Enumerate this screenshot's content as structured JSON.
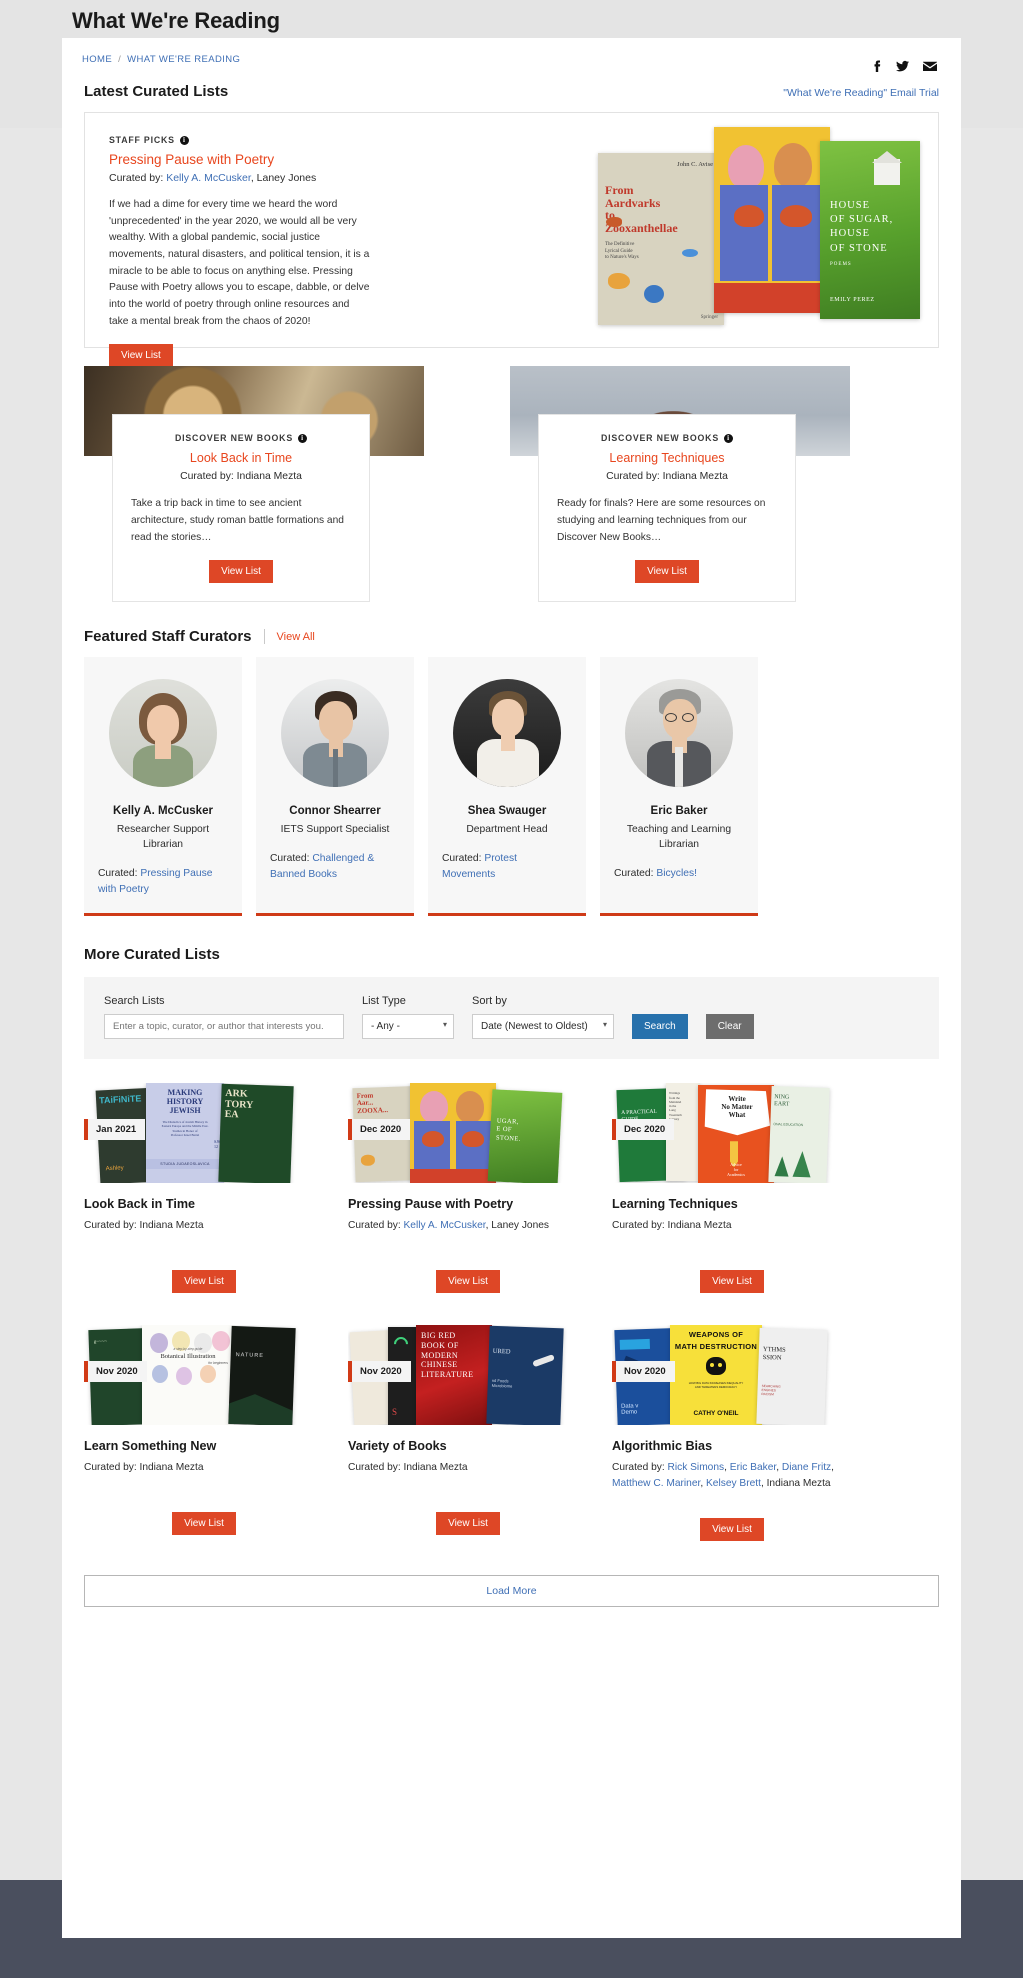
{
  "page_heading": "What We're Reading",
  "breadcrumb": {
    "home": "HOME",
    "separator": "/",
    "current": "WHAT WE'RE READING"
  },
  "social": {
    "facebook": "facebook-icon",
    "twitter": "twitter-icon",
    "email": "email-icon"
  },
  "latest": {
    "heading": "Latest Curated Lists",
    "email_trial": "\"What We're Reading\" Email Trial"
  },
  "hero": {
    "kicker": "STAFF PICKS",
    "info_glyph": "i",
    "title": "Pressing Pause with Poetry",
    "curated_prefix": "Curated by: ",
    "curator_link": "Kelly A. McCusker",
    "curator_rest": ", Laney Jones",
    "description": "If we had a dime for every time we heard the word 'unprecedented' in the year 2020, we would all be very wealthy. With a global pandemic, social justice movements, natural disasters, and political tension, it is a miracle to be able to focus on anything else. Pressing Pause with Poetry allows you to escape, dabble, or delve into the world of poetry through online resources and take a mental break from the chaos of 2020!",
    "button": "View List",
    "books": [
      {
        "title": "From Aardvarks to Zooxanthellae",
        "author": "John C. Avise",
        "subtitle": "The Definitive Lyrical Guide to Nature's Ways",
        "publisher": "Springer"
      },
      {
        "title": "House of Sugar, House of Stone",
        "author": "Emily Perez"
      }
    ]
  },
  "discover_cards": [
    {
      "kicker": "DISCOVER NEW BOOKS",
      "title": "Look Back in Time",
      "curated": "Curated by: Indiana Mezta",
      "description": "Take a trip back in time to see ancient architecture, study roman battle formations and read the stories…",
      "button": "View List",
      "image": "pocket-watches-photo"
    },
    {
      "kicker": "DISCOVER NEW BOOKS",
      "title": "Learning Techniques",
      "curated": "Curated by: Indiana Mezta",
      "description": "Ready for finals? Here are some resources on studying and learning techniques from our Discover New Books…",
      "button": "View List",
      "image": "student-at-desk-photo"
    }
  ],
  "curators_section": {
    "heading": "Featured Staff Curators",
    "view_all": "View All",
    "items": [
      {
        "name": "Kelly A. McCusker",
        "role": "Researcher Support Librarian",
        "curated_prefix": "Curated: ",
        "curated_link": "Pressing Pause with Poetry"
      },
      {
        "name": "Connor Shearrer",
        "role": "IETS Support Specialist",
        "curated_prefix": "Curated: ",
        "curated_link": "Challenged & Banned Books"
      },
      {
        "name": "Shea Swauger",
        "role": "Department Head",
        "curated_prefix": "Curated: ",
        "curated_link": "Protest Movements"
      },
      {
        "name": "Eric Baker",
        "role": "Teaching and Learning Librarian",
        "curated_prefix": "Curated: ",
        "curated_link": "Bicycles!"
      }
    ]
  },
  "more_section": {
    "heading": "More Curated Lists",
    "search_label": "Search Lists",
    "search_placeholder": "Enter a topic, curator, or author that interests you.",
    "search_value": "",
    "list_type_label": "List Type",
    "list_type_value": "- Any -",
    "sort_label": "Sort by",
    "sort_value": "Date (Newest to Oldest)",
    "search_button": "Search",
    "clear_button": "Clear"
  },
  "results": [
    {
      "date": "Jan 2021",
      "title": "Look Back in Time",
      "curated_prefix": "Curated by: ",
      "curated_plain": "Indiana Mezta",
      "curated_links": [],
      "button": "View List"
    },
    {
      "date": "Dec 2020",
      "title": "Pressing Pause with Poetry",
      "curated_prefix": "Curated by: ",
      "curated_plain": ", Laney Jones",
      "curated_links": [
        "Kelly A. McCusker"
      ],
      "button": "View List"
    },
    {
      "date": "Dec 2020",
      "title": "Learning Techniques",
      "curated_prefix": "Curated by: ",
      "curated_plain": "Indiana Mezta",
      "curated_links": [],
      "button": "View List"
    },
    {
      "date": "Nov 2020",
      "title": "Learn Something New",
      "curated_prefix": "Curated by: ",
      "curated_plain": "Indiana Mezta",
      "curated_links": [],
      "button": "View List"
    },
    {
      "date": "Nov 2020",
      "title": "Variety of Books",
      "curated_prefix": "Curated by: ",
      "curated_plain": "Indiana Mezta",
      "curated_links": [],
      "button": "View List"
    },
    {
      "date": "Nov 2020",
      "title": "Algorithmic Bias",
      "curated_prefix": "Curated by: ",
      "curated_plain": ", Indiana Mezta",
      "curated_links": [
        "Rick Simons",
        "Eric Baker",
        "Diane Fritz",
        "Matthew C. Mariner",
        "Kelsey Brett"
      ],
      "button": "View List"
    }
  ],
  "load_more": "Load More",
  "colors": {
    "accent_red": "#de4726",
    "link_blue": "#3f6fb5",
    "search_blue": "#2771ac",
    "clear_grey": "#6d6d6d",
    "badge_bar": "#d13a16",
    "curator_underline": "#cf3a17",
    "page_bg": "#e7e7e7",
    "footer_dark": "#4a4f5e"
  }
}
